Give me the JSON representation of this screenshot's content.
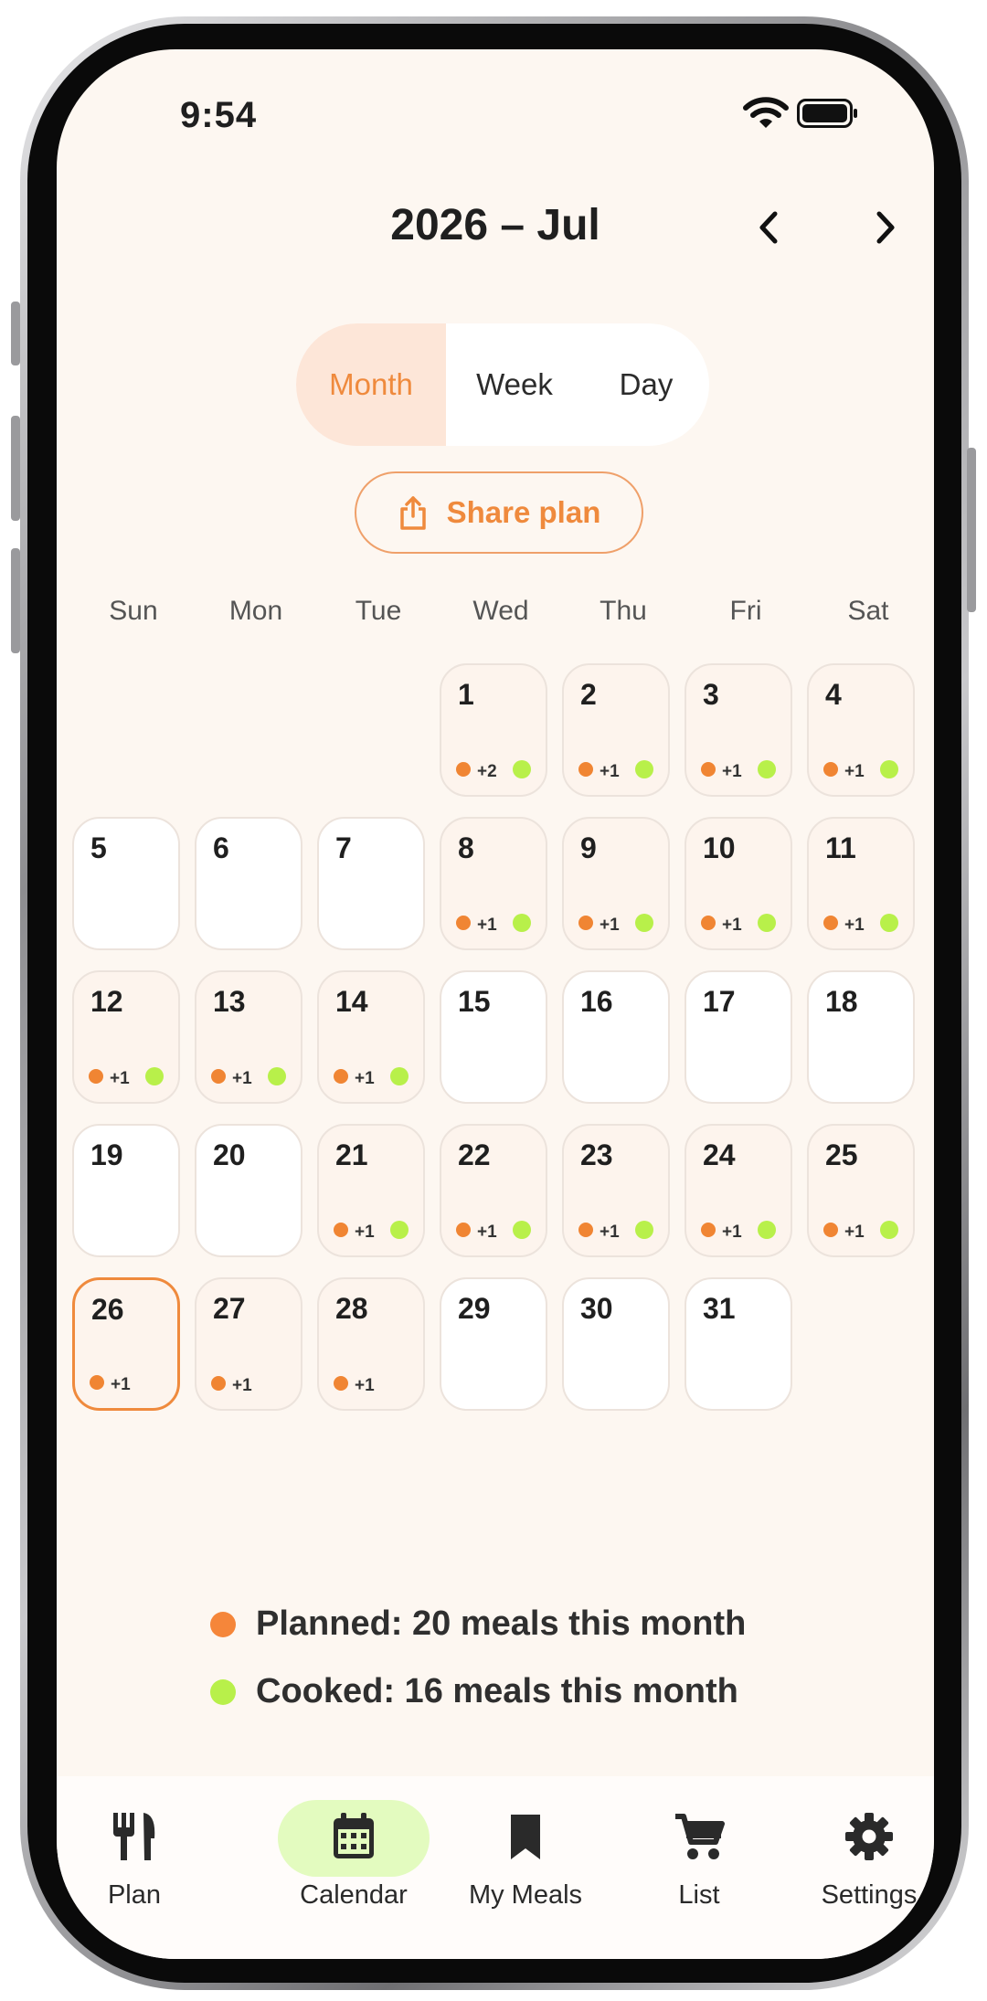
{
  "status_bar": {
    "time": "9:54"
  },
  "header": {
    "title": "2026 – Jul"
  },
  "view_toggle": {
    "month": "Month",
    "week": "Week",
    "day": "Day",
    "selected": "Month"
  },
  "share": {
    "label": "Share plan"
  },
  "weekdays": [
    "Sun",
    "Mon",
    "Tue",
    "Wed",
    "Thu",
    "Fri",
    "Sat"
  ],
  "calendar": {
    "days": [
      {
        "d": "1",
        "extra": "+2",
        "cooked": true
      },
      {
        "d": "2",
        "extra": "+1",
        "cooked": true
      },
      {
        "d": "3",
        "extra": "+1",
        "cooked": true
      },
      {
        "d": "4",
        "extra": "+1",
        "cooked": true
      },
      {
        "d": "5",
        "extra": "",
        "cooked": false
      },
      {
        "d": "6",
        "extra": "",
        "cooked": false
      },
      {
        "d": "7",
        "extra": "",
        "cooked": false
      },
      {
        "d": "8",
        "extra": "+1",
        "cooked": true
      },
      {
        "d": "9",
        "extra": "+1",
        "cooked": true
      },
      {
        "d": "10",
        "extra": "+1",
        "cooked": true
      },
      {
        "d": "11",
        "extra": "+1",
        "cooked": true
      },
      {
        "d": "12",
        "extra": "+1",
        "cooked": true
      },
      {
        "d": "13",
        "extra": "+1",
        "cooked": true
      },
      {
        "d": "14",
        "extra": "+1",
        "cooked": true
      },
      {
        "d": "15",
        "extra": "",
        "cooked": false
      },
      {
        "d": "16",
        "extra": "",
        "cooked": false
      },
      {
        "d": "17",
        "extra": "",
        "cooked": false
      },
      {
        "d": "18",
        "extra": "",
        "cooked": false
      },
      {
        "d": "19",
        "extra": "",
        "cooked": false
      },
      {
        "d": "20",
        "extra": "",
        "cooked": false
      },
      {
        "d": "21",
        "extra": "+1",
        "cooked": true
      },
      {
        "d": "22",
        "extra": "+1",
        "cooked": true
      },
      {
        "d": "23",
        "extra": "+1",
        "cooked": true
      },
      {
        "d": "24",
        "extra": "+1",
        "cooked": true
      },
      {
        "d": "25",
        "extra": "+1",
        "cooked": true
      },
      {
        "d": "26",
        "extra": "+1",
        "cooked": false,
        "today": true
      },
      {
        "d": "27",
        "extra": "+1",
        "cooked": false
      },
      {
        "d": "28",
        "extra": "+1",
        "cooked": false
      },
      {
        "d": "29",
        "extra": "",
        "cooked": false
      },
      {
        "d": "30",
        "extra": "",
        "cooked": false
      },
      {
        "d": "31",
        "extra": "",
        "cooked": false
      }
    ]
  },
  "legend": {
    "planned": "Planned: 20 meals this month",
    "cooked": "Cooked: 16 meals this month"
  },
  "bottom_nav": [
    {
      "label": "Plan",
      "icon": "fork-knife-icon"
    },
    {
      "label": "Calendar",
      "icon": "calendar-icon",
      "active": true
    },
    {
      "label": "My Meals",
      "icon": "bookmark-icon"
    },
    {
      "label": "List",
      "icon": "cart-icon"
    },
    {
      "label": "Settings",
      "icon": "gear-icon"
    }
  ],
  "colors": {
    "accent": "#ef8a3d",
    "planned_dot": "#f08533",
    "cooked_dot": "#b8f04a",
    "background": "#fdf7f1",
    "nav_active": "#e3fbbf"
  }
}
